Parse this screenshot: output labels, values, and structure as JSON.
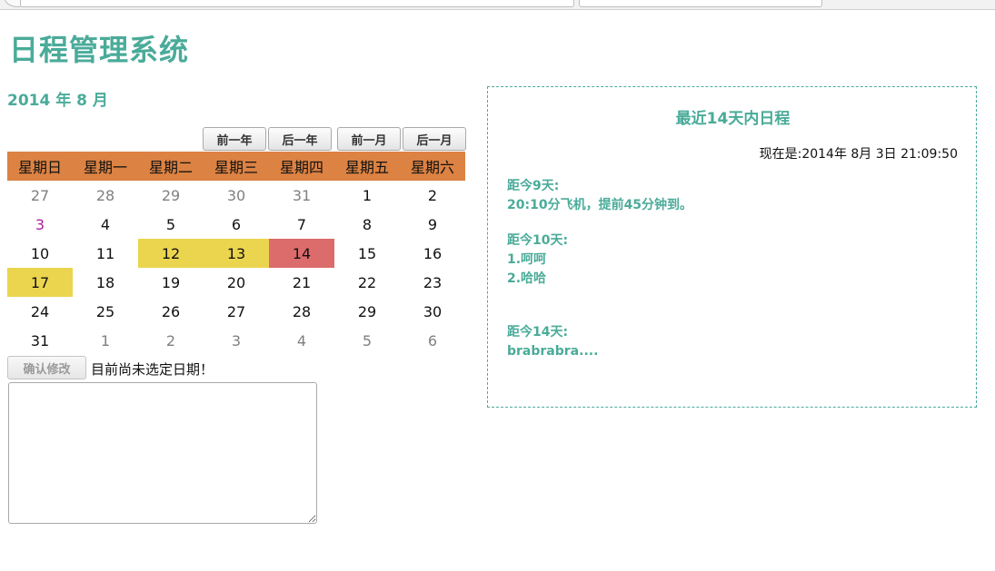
{
  "app": {
    "title": "日程管理系统"
  },
  "calendar": {
    "month_title": "2014 年 8 月",
    "nav": {
      "prev_year": "前一年",
      "next_year": "后一年",
      "prev_month": "前一月",
      "next_month": "后一月"
    },
    "weekdays": [
      "星期日",
      "星期一",
      "星期二",
      "星期三",
      "星期四",
      "星期五",
      "星期六"
    ],
    "weeks": [
      [
        {
          "d": "27",
          "t": "other"
        },
        {
          "d": "28",
          "t": "other"
        },
        {
          "d": "29",
          "t": "other"
        },
        {
          "d": "30",
          "t": "other"
        },
        {
          "d": "31",
          "t": "other"
        },
        {
          "d": "1",
          "t": ""
        },
        {
          "d": "2",
          "t": ""
        }
      ],
      [
        {
          "d": "3",
          "t": "today"
        },
        {
          "d": "4",
          "t": ""
        },
        {
          "d": "5",
          "t": ""
        },
        {
          "d": "6",
          "t": ""
        },
        {
          "d": "7",
          "t": ""
        },
        {
          "d": "8",
          "t": ""
        },
        {
          "d": "9",
          "t": ""
        }
      ],
      [
        {
          "d": "10",
          "t": ""
        },
        {
          "d": "11",
          "t": ""
        },
        {
          "d": "12",
          "t": "yellow"
        },
        {
          "d": "13",
          "t": "yellow"
        },
        {
          "d": "14",
          "t": "red"
        },
        {
          "d": "15",
          "t": ""
        },
        {
          "d": "16",
          "t": ""
        }
      ],
      [
        {
          "d": "17",
          "t": "yellow"
        },
        {
          "d": "18",
          "t": ""
        },
        {
          "d": "19",
          "t": ""
        },
        {
          "d": "20",
          "t": ""
        },
        {
          "d": "21",
          "t": ""
        },
        {
          "d": "22",
          "t": ""
        },
        {
          "d": "23",
          "t": ""
        }
      ],
      [
        {
          "d": "24",
          "t": ""
        },
        {
          "d": "25",
          "t": ""
        },
        {
          "d": "26",
          "t": ""
        },
        {
          "d": "27",
          "t": ""
        },
        {
          "d": "28",
          "t": ""
        },
        {
          "d": "29",
          "t": ""
        },
        {
          "d": "30",
          "t": ""
        }
      ],
      [
        {
          "d": "31",
          "t": ""
        },
        {
          "d": "1",
          "t": "other"
        },
        {
          "d": "2",
          "t": "other"
        },
        {
          "d": "3",
          "t": "other"
        },
        {
          "d": "4",
          "t": "other"
        },
        {
          "d": "5",
          "t": "other"
        },
        {
          "d": "6",
          "t": "other"
        }
      ]
    ],
    "colors": {
      "header_bg": "#dc8243",
      "highlight_yellow": "#ecd54e",
      "highlight_red": "#dc6b6b",
      "today_text": "#aa1f9a",
      "accent": "#4aab99"
    }
  },
  "editor": {
    "confirm_label": "确认修改",
    "status": "目前尚未选定日期！",
    "note_value": ""
  },
  "schedule": {
    "title": "最近14天内日程",
    "now": "现在是:2014年 8月 3日 21:09:50",
    "groups": [
      {
        "label": "距今9天:",
        "items": [
          "20:10分飞机，提前45分钟到。"
        ]
      },
      {
        "label": "距今10天:",
        "items": [
          "1.呵呵",
          "2.哈哈"
        ]
      },
      {
        "label": "距今14天:",
        "items": [
          "brabrabra...."
        ]
      }
    ]
  }
}
